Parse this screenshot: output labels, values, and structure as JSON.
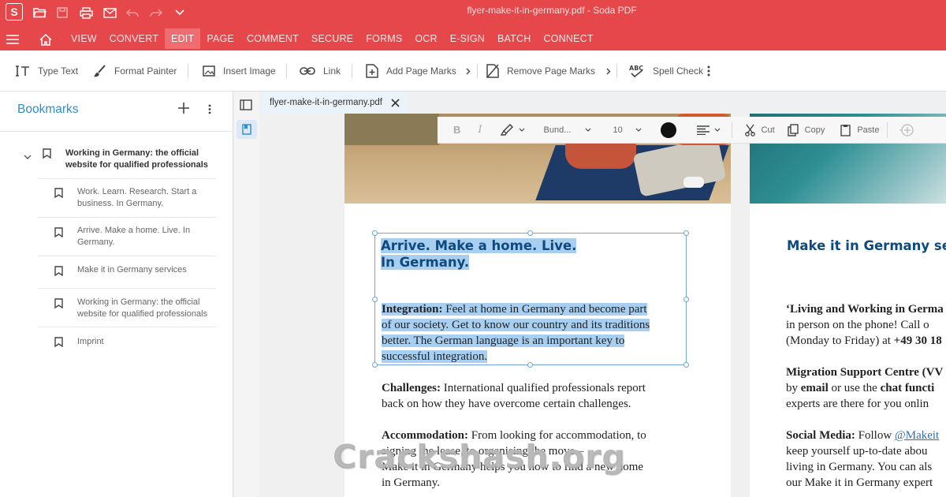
{
  "window": {
    "title": "flyer-make-it-in-germany.pdf   -   Soda PDF",
    "logo_letter": "S"
  },
  "menu": [
    "VIEW",
    "CONVERT",
    "EDIT",
    "PAGE",
    "COMMENT",
    "SECURE",
    "FORMS",
    "OCR",
    "E-SIGN",
    "BATCH",
    "CONNECT"
  ],
  "active_menu": "EDIT",
  "toolbar": {
    "type_text": "Type Text",
    "format_painter": "Format Painter",
    "insert_image": "Insert Image",
    "link": "Link",
    "add_page_marks": "Add Page Marks",
    "remove_page_marks": "Remove Page Marks",
    "spell_check": "Spell Check"
  },
  "sidebar": {
    "title": "Bookmarks",
    "items": [
      {
        "label": "Working in Germany: the official website for qualified professionals"
      },
      {
        "label": "Work. Learn. Research. Start a business. In Germany."
      },
      {
        "label": "Arrive. Make a home. Live. In Germany."
      },
      {
        "label": "Make it in Germany services"
      },
      {
        "label": "Working in Germany: the official website for qualified professionals"
      },
      {
        "label": "Imprint"
      }
    ]
  },
  "doc_tab": "flyer-make-it-in-germany.pdf",
  "format_bar": {
    "bold": "B",
    "italic": "I",
    "font": "Bund...",
    "size": "10",
    "cut": "Cut",
    "copy": "Copy",
    "paste": "Paste"
  },
  "page1": {
    "heading_line1": "Arrive. Make a home. Live.",
    "heading_line2": "In Germany.",
    "integration_label": "Integration:",
    "integration_lines": [
      " Feel at home in Germany and become part",
      "of our society. Get to know our country and its traditions",
      "better. The German language is an important key to",
      "successful integration."
    ],
    "challenges_label": "Challenges:",
    "challenges_lines": [
      " International qualified professionals report",
      "back on how they have overcome certain challenges."
    ],
    "accommodation_label": "Accommodation:",
    "accommodation_lines": [
      " From looking for accommodation, to",
      "signing the lease, to organising the move –",
      "Make it in Germany helps you how to find a new home",
      "in Germany."
    ]
  },
  "page2": {
    "heading": "Make it in Germany servi",
    "living_label": "‘Living and Working in Germa",
    "living_lines": [
      "in person on the phone! Call o",
      "(Monday to Friday) at "
    ],
    "phone": "+49 30 18",
    "migration_label": "Migration Support Centre (VV",
    "migration_lines": [
      "by ",
      "email",
      " or use the ",
      "chat functi"
    ],
    "experts_line": "experts are there for you onlin",
    "social_label": "Social Media:",
    "social_follow": " Follow ",
    "social_handle": "@Makeit",
    "social_lines": [
      "keep yourself up-to-date abou",
      "living in Germany. You can als",
      "our Make it in Germany expert"
    ]
  },
  "watermark": "Crackshash.org",
  "colors": {
    "brand": "#e6474b",
    "active_tab": "#ef6d70",
    "heading": "#0e4a80",
    "highlight": "#a8cff0",
    "link": "#2e8ccf"
  }
}
